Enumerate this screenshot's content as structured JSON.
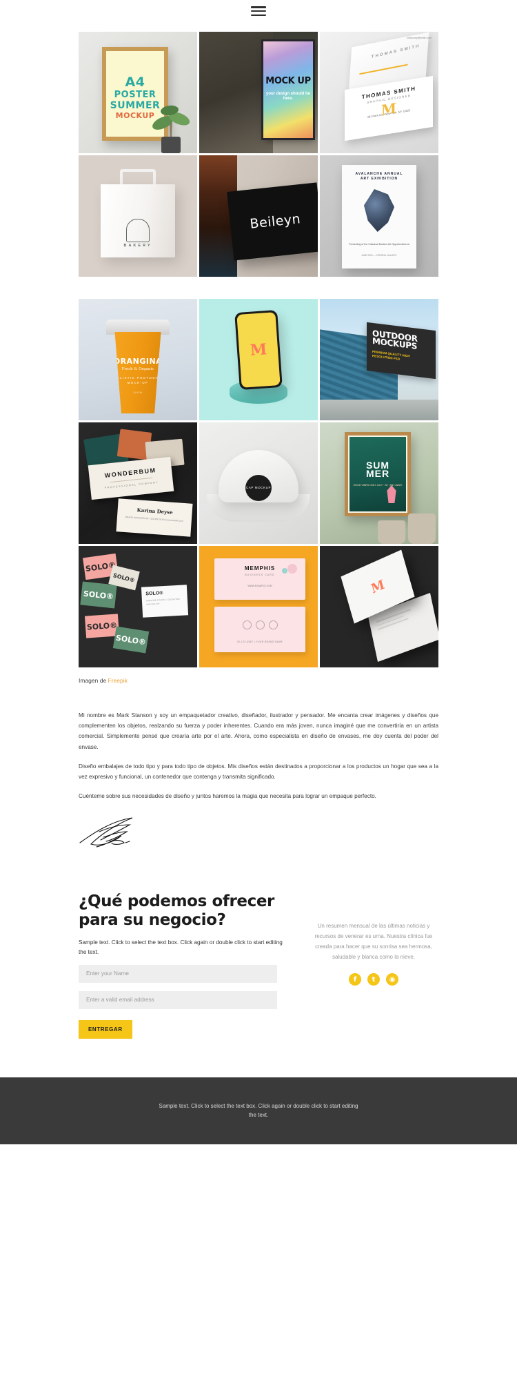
{
  "header": {
    "menu_icon": "hamburger-menu-icon"
  },
  "gallery_one": {
    "items": [
      {
        "name": "a4-poster-summer-mockup",
        "lines": [
          "A4",
          "POSTER",
          "SUMMER",
          "MOCKUP"
        ]
      },
      {
        "name": "street-digital-billboard-mockup",
        "headline": "MOCK UP",
        "sub": "your design should be here.",
        "chip": ""
      },
      {
        "name": "thomas-smith-business-card-mockup",
        "brand": "THOMAS SMITH",
        "name_line": "THOMAS SMITH",
        "role": "GRAPHIC DESIGNER",
        "address": "481 Park Ave, New York, NY 10022",
        "email": "company@mail.com",
        "monogram": "M"
      },
      {
        "name": "bakery-paper-bag-mockup",
        "logo_text": "BAKERY"
      },
      {
        "name": "beileyn-black-sign-mockup",
        "label": "Beileyn"
      },
      {
        "name": "avalanche-art-exhibition-poster-mockup",
        "t1": "AVALANCHE ANNUAL",
        "t2": "ART EXHIBITION",
        "t3": "Presenting of the Classical Modern Art Opportunities at",
        "t4": "JUNE 2020 — CENTRAL GALLERY"
      }
    ]
  },
  "gallery_two": {
    "items": [
      {
        "name": "orangina-cup-mockup",
        "n1": "ORANGINA",
        "n2": "Fresh & Organic",
        "n3": "REALISTIC PHOTOSHOP MOCK-UP",
        "n4": "100%"
      },
      {
        "name": "phone-pedestal-mockup",
        "glyph": "M"
      },
      {
        "name": "outdoor-billboard-mockup",
        "o1": "OUTDOOR MOCKUPS",
        "o2": "PREMIUM QUALITY HIGH RESOLUTION PSD"
      },
      {
        "name": "wonderbum-business-card-mockup",
        "title": "WONDERBUM",
        "subtitle": "PROFESSIONAL COMPANY",
        "person": "Karina Deyse",
        "details": "BRAND MANAGER HR\n+123 456 78 90\nwww.example.com"
      },
      {
        "name": "cap-mockup",
        "patch": "CAP MOCKUP"
      },
      {
        "name": "summer-poster-plants-mockup",
        "s1": "SUM",
        "s2": "MER",
        "s3": "GOOD VIBES ONLY\nJULY · 28 · ANY AWAY"
      },
      {
        "name": "solo-branding-mockup",
        "word": "SOLO®",
        "card_title": "SOLO®",
        "card_body": "CREATIVE STUDIO\n+1 234 567 890\nwww.solo.com"
      },
      {
        "name": "memphis-business-card-mockup",
        "title": "MEMPHIS",
        "subtitle": "BUSINESS CARD",
        "web": "WWW.EXAMPLE.COM",
        "footer": "00-123-4567  |  YOUR BRAND NAME"
      },
      {
        "name": "folded-letterhead-mockup",
        "glyph": "M"
      }
    ]
  },
  "credit": {
    "prefix": "Imagen de ",
    "link_label": "Freepik"
  },
  "about": {
    "paragraphs": [
      "Mi nombre es Mark Stanson y soy un empaquetador creativo, diseñador, ilustrador y pensador. Me encanta crear imágenes y diseños que complementen los objetos, realzando su fuerza y poder inherentes. Cuando era más joven, nunca imaginé que me convertiría en un artista comercial. Simplemente pensé que crearía arte por el arte. Ahora, como especialista en diseño de envases, me doy cuenta del poder del envase.",
      "Diseño embalajes de todo tipo y para todo tipo de objetos. Mis diseños están destinados a proporcionar a los productos un hogar que sea a la vez expresivo y funcional, un contenedor que contenga y transmita significado.",
      "Cuénteme sobre sus necesidades de diseño y juntos haremos la magia que necesita para lograr un empaque perfecto."
    ],
    "signature_name": "signature-mark-stanson"
  },
  "contact": {
    "heading_line1": "¿Qué podemos ofrecer",
    "heading_line2": "para su negocio?",
    "sample_text": "Sample text. Click to select the text box. Click again or double click to start editing the text.",
    "name_placeholder": "Enter your Name",
    "email_placeholder": "Enter a valid email address",
    "submit_label": "ENTREGAR",
    "newsletter_text": "Un resumen mensual de las últimas noticias y recursos de venerar es urna. Nuestra clínica fue creada para hacer que su sonrisa sea hermosa, saludable y blanca como la nieve.",
    "socials": [
      {
        "name": "facebook-icon",
        "glyph": "f"
      },
      {
        "name": "twitter-icon",
        "glyph": "t"
      },
      {
        "name": "instagram-icon",
        "glyph": "◉"
      }
    ]
  },
  "footer": {
    "text": "Sample text. Click to select the text box. Click again or double click to start editing the text."
  },
  "colors": {
    "accent_yellow": "#f5c518",
    "link_orange": "#e9a33c",
    "footer_bg": "#3a3a3a",
    "field_bg": "#eeeeee"
  }
}
